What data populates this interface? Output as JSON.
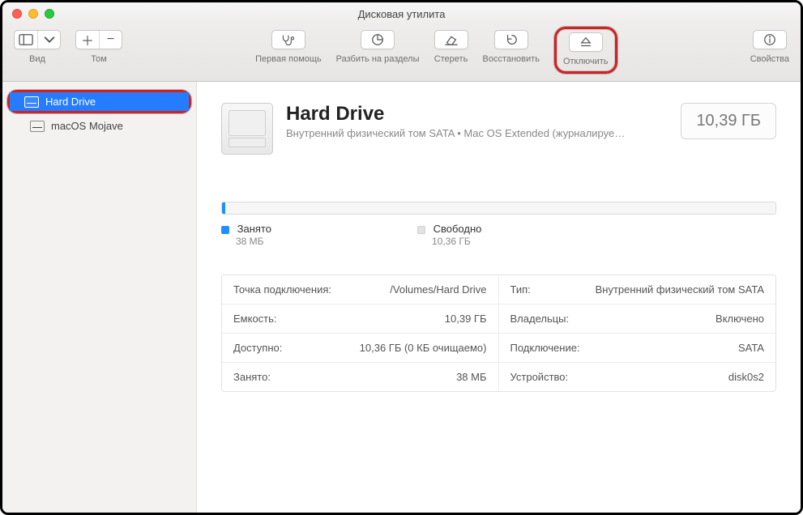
{
  "window": {
    "title": "Дисковая утилита"
  },
  "toolbar": {
    "view": {
      "label": "Вид"
    },
    "volume": {
      "label": "Том"
    },
    "first_aid": {
      "label": "Первая помощь"
    },
    "partition": {
      "label": "Разбить на разделы"
    },
    "erase": {
      "label": "Стереть"
    },
    "restore": {
      "label": "Восстановить"
    },
    "unmount": {
      "label": "Отключить"
    },
    "info": {
      "label": "Свойства"
    }
  },
  "sidebar": {
    "items": [
      {
        "label": "Hard Drive",
        "selected": true
      },
      {
        "label": "macOS Mojave",
        "selected": false
      }
    ]
  },
  "main": {
    "name": "Hard Drive",
    "subtitle": "Внутренний физический том SATA • Mac OS Extended (журналируе…",
    "capacity_badge": "10,39 ГБ",
    "legend": {
      "used_label": "Занято",
      "used_value": "38 МБ",
      "free_label": "Свободно",
      "free_value": "10,36 ГБ"
    },
    "info_left": [
      {
        "k": "Точка подключения:",
        "v": "/Volumes/Hard Drive"
      },
      {
        "k": "Емкость:",
        "v": "10,39 ГБ"
      },
      {
        "k": "Доступно:",
        "v": "10,36 ГБ (0 КБ очищаемо)"
      },
      {
        "k": "Занято:",
        "v": "38 МБ"
      }
    ],
    "info_right": [
      {
        "k": "Тип:",
        "v": "Внутренний физический том SATA"
      },
      {
        "k": "Владельцы:",
        "v": "Включено"
      },
      {
        "k": "Подключение:",
        "v": "SATA"
      },
      {
        "k": "Устройство:",
        "v": "disk0s2"
      }
    ]
  }
}
